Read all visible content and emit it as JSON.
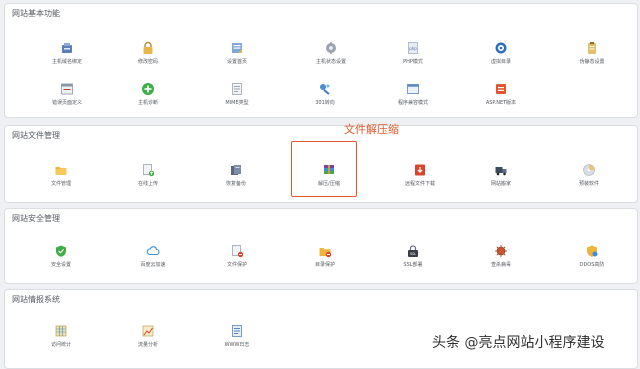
{
  "sections": [
    {
      "title": "网站基本功能",
      "items": [
        {
          "label": "主机域名绑定",
          "icon": "domain-binding-icon"
        },
        {
          "label": "修改密码",
          "icon": "lock-icon"
        },
        {
          "label": "设置首页",
          "icon": "homepage-icon"
        },
        {
          "label": "主机状态设置",
          "icon": "gear-icon"
        },
        {
          "label": "PHP模式",
          "icon": "php-file-icon"
        },
        {
          "label": "虚拟目录",
          "icon": "virtual-directory-icon"
        },
        {
          "label": "伪静态设置",
          "icon": "clipboard-icon"
        },
        {
          "label": "错误页面定义",
          "icon": "error-page-icon"
        },
        {
          "label": "主机诊断",
          "icon": "diagnosis-plus-icon"
        },
        {
          "label": "MIME类型",
          "icon": "mime-file-icon"
        },
        {
          "label": "301转向",
          "icon": "redirect-icon"
        },
        {
          "label": "程序兼容模式",
          "icon": "window-icon"
        },
        {
          "label": "ASP.NET版本",
          "icon": "aspnet-icon"
        }
      ]
    },
    {
      "title": "网站文件管理",
      "items": [
        {
          "label": "文件管理",
          "icon": "folder-icon"
        },
        {
          "label": "在线上传",
          "icon": "upload-file-icon"
        },
        {
          "label": "恢复备份",
          "icon": "backup-restore-icon"
        },
        {
          "label": "解压/压缩",
          "icon": "archive-icon"
        },
        {
          "label": "远程文件下载",
          "icon": "download-icon"
        },
        {
          "label": "网站搬家",
          "icon": "truck-icon"
        },
        {
          "label": "预装软件",
          "icon": "disc-icon"
        }
      ]
    },
    {
      "title": "网站安全管理",
      "items": [
        {
          "label": "安全设置",
          "icon": "shield-icon"
        },
        {
          "label": "百度云加速",
          "icon": "cloud-icon"
        },
        {
          "label": "文件保护",
          "icon": "file-protect-icon"
        },
        {
          "label": "目录保护",
          "icon": "folder-protect-icon"
        },
        {
          "label": "SSL部署",
          "icon": "ssl-icon"
        },
        {
          "label": "查杀病毒",
          "icon": "virus-scan-icon"
        },
        {
          "label": "DDOS高防",
          "icon": "ddos-shield-icon"
        }
      ]
    },
    {
      "title": "网站情报系统",
      "items": [
        {
          "label": "访问统计",
          "icon": "calendar-stats-icon"
        },
        {
          "label": "流量分析",
          "icon": "traffic-chart-icon"
        },
        {
          "label": "WWW日志",
          "icon": "log-file-icon"
        }
      ]
    }
  ],
  "callout": "文件解压缩",
  "watermark": "头条 @亮点网站小程序建设",
  "colors": {
    "accent": "#e05a2b",
    "panel_border": "#dadde2",
    "text": "#555a60"
  }
}
